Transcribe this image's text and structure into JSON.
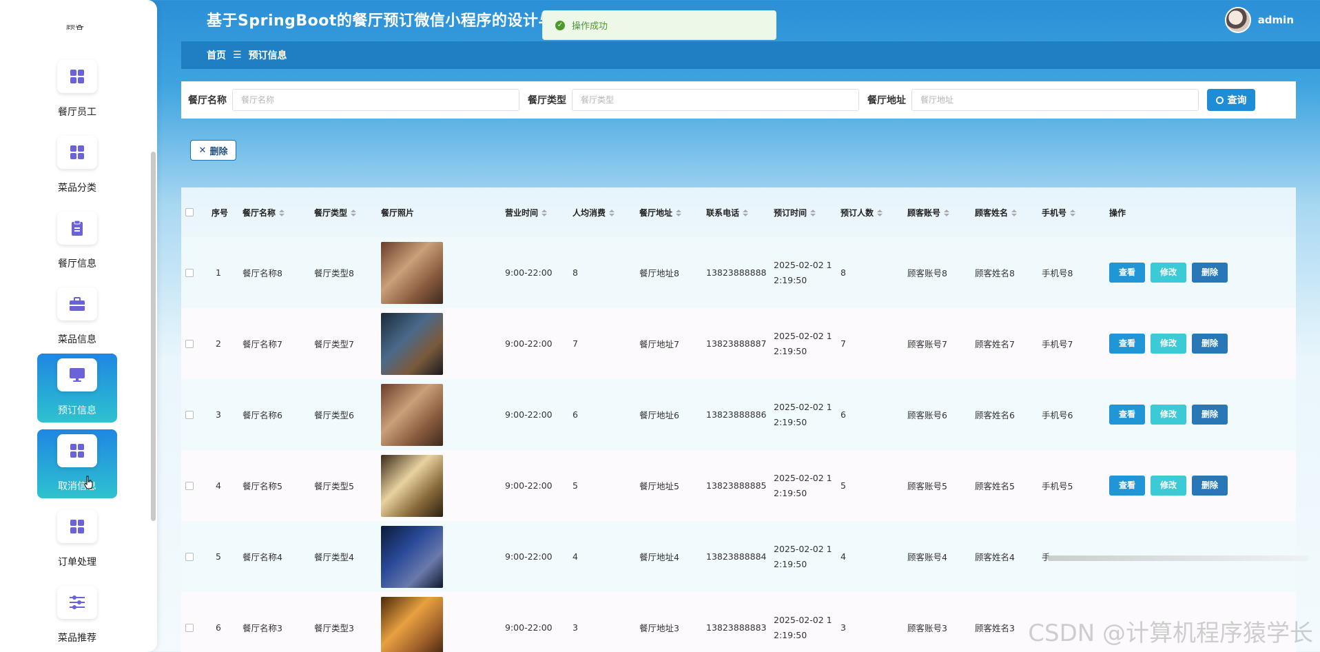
{
  "app": {
    "title": "基于SpringBoot的餐厅预订微信小程序的设计与实",
    "user": "admin"
  },
  "toast": {
    "text": "操作成功"
  },
  "breadcrumb": {
    "home": "首页",
    "sep": "☰",
    "current": "预订信息"
  },
  "sidebar": {
    "clipped_label": "顾客",
    "items": [
      {
        "label": "餐厅员工",
        "icon": "grid-icon"
      },
      {
        "label": "菜品分类",
        "icon": "grid-icon"
      },
      {
        "label": "餐厅信息",
        "icon": "clipboard-icon"
      },
      {
        "label": "菜品信息",
        "icon": "briefcase-icon"
      },
      {
        "label": "预订信息",
        "icon": "monitor-icon",
        "active": true
      },
      {
        "label": "取消信息",
        "icon": "grid-icon",
        "active": true
      },
      {
        "label": "订单处理",
        "icon": "grid-icon"
      },
      {
        "label": "菜品推荐",
        "icon": "sliders-icon"
      }
    ]
  },
  "search": {
    "fields": [
      {
        "label": "餐厅名称",
        "placeholder": "餐厅名称"
      },
      {
        "label": "餐厅类型",
        "placeholder": "餐厅类型"
      },
      {
        "label": "餐厅地址",
        "placeholder": "餐厅地址"
      }
    ],
    "button": "查询"
  },
  "toolbar": {
    "delete_label": "删除"
  },
  "table": {
    "headers": [
      "序号",
      "餐厅名称",
      "餐厅类型",
      "餐厅照片",
      "营业时间",
      "人均消费",
      "餐厅地址",
      "联系电话",
      "预订时间",
      "预订人数",
      "顾客账号",
      "顾客姓名",
      "手机号",
      "操作"
    ],
    "actions": {
      "view": "查看",
      "edit": "修改",
      "delete": "删除"
    },
    "rows": [
      {
        "idx": "1",
        "name": "餐厅名称8",
        "type": "餐厅类型8",
        "hours": "9:00-22:00",
        "avg": "8",
        "addr": "餐厅地址8",
        "phone": "13823888888",
        "time": "2025-02-02 12:19:50",
        "people": "8",
        "account": "顾客账号8",
        "cname": "顾客姓名8",
        "mobile": "手机号8"
      },
      {
        "idx": "2",
        "name": "餐厅名称7",
        "type": "餐厅类型7",
        "hours": "9:00-22:00",
        "avg": "7",
        "addr": "餐厅地址7",
        "phone": "13823888887",
        "time": "2025-02-02 12:19:50",
        "people": "7",
        "account": "顾客账号7",
        "cname": "顾客姓名7",
        "mobile": "手机号7"
      },
      {
        "idx": "3",
        "name": "餐厅名称6",
        "type": "餐厅类型6",
        "hours": "9:00-22:00",
        "avg": "6",
        "addr": "餐厅地址6",
        "phone": "13823888886",
        "time": "2025-02-02 12:19:50",
        "people": "6",
        "account": "顾客账号6",
        "cname": "顾客姓名6",
        "mobile": "手机号6"
      },
      {
        "idx": "4",
        "name": "餐厅名称5",
        "type": "餐厅类型5",
        "hours": "9:00-22:00",
        "avg": "5",
        "addr": "餐厅地址5",
        "phone": "13823888885",
        "time": "2025-02-02 12:19:50",
        "people": "5",
        "account": "顾客账号5",
        "cname": "顾客姓名5",
        "mobile": "手机号5"
      },
      {
        "idx": "5",
        "name": "餐厅名称4",
        "type": "餐厅类型4",
        "hours": "9:00-22:00",
        "avg": "4",
        "addr": "餐厅地址4",
        "phone": "13823888884",
        "time": "2025-02-02 12:19:50",
        "people": "4",
        "account": "顾客账号4",
        "cname": "顾客姓名4",
        "mobile": "手"
      },
      {
        "idx": "6",
        "name": "餐厅名称3",
        "type": "餐厅类型3",
        "hours": "9:00-22:00",
        "avg": "3",
        "addr": "餐厅地址3",
        "phone": "13823888883",
        "time": "2025-02-02 12:19:50",
        "people": "3",
        "account": "顾客账号3",
        "cname": "顾客姓名3",
        "mobile": ""
      }
    ]
  },
  "watermark": "CSDN @计算机程序猿学长"
}
